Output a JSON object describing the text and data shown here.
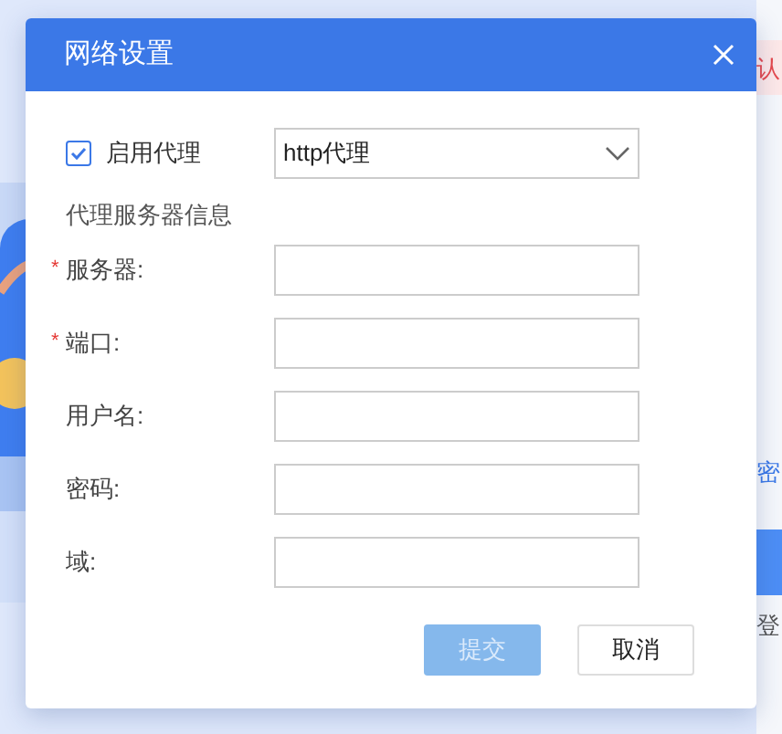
{
  "window": {
    "title": "网络设置"
  },
  "proxy": {
    "label": "启用代理",
    "checked": true,
    "type": "http代理"
  },
  "section_title": "代理服务器信息",
  "fields": [
    {
      "label": "服务器:",
      "required_mark": "*"
    },
    {
      "label": "端口:",
      "required_mark": "*"
    },
    {
      "label": "用户名:"
    },
    {
      "label": "密码:"
    },
    {
      "label": "域:"
    }
  ],
  "buttons": [
    {
      "label": "提交",
      "kind": "primary",
      "disabled": true
    },
    {
      "label": "取消",
      "kind": "secondary",
      "disabled": false
    }
  ],
  "background": [
    {
      "kind": "alert",
      "text": "认"
    },
    {
      "kind": "link",
      "text": "密"
    },
    {
      "kind": "button"
    },
    {
      "kind": "text",
      "text": "登"
    }
  ]
}
